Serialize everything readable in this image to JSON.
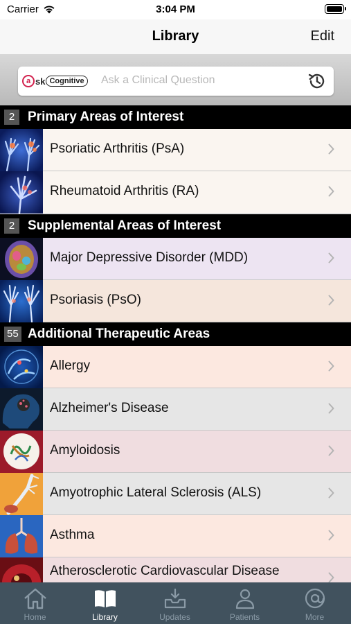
{
  "status": {
    "carrier": "Carrier",
    "time": "3:04 PM"
  },
  "nav": {
    "title": "Library",
    "edit": "Edit"
  },
  "search": {
    "logo_ask": "sk",
    "logo_brand": "Cognitive",
    "placeholder": "Ask a Clinical Question",
    "icon": "history-icon"
  },
  "sections": [
    {
      "count": "2",
      "title": "Primary Areas of Interest",
      "items": [
        {
          "label": "Psoriatic Arthritis (PsA)",
          "bg": "#faf5f0",
          "thumb": "hands-xray"
        },
        {
          "label": "Rheumatoid Arthritis (RA)",
          "bg": "#faf5f0",
          "thumb": "hand-xray"
        }
      ]
    },
    {
      "count": "2",
      "title": "Supplemental Areas of Interest",
      "items": [
        {
          "label": "Major Depressive Disorder (MDD)",
          "bg": "#ede4f2",
          "thumb": "brain-scan"
        },
        {
          "label": "Psoriasis (PsO)",
          "bg": "#f5e6dc",
          "thumb": "hands-blue"
        }
      ]
    },
    {
      "count": "55",
      "title": "Additional Therapeutic Areas",
      "items": [
        {
          "label": "Allergy",
          "bg": "#fce8e0",
          "thumb": "allergy-molecule"
        },
        {
          "label": "Alzheimer's Disease",
          "bg": "#e6e6e6",
          "thumb": "brain-dark"
        },
        {
          "label": "Amyloidosis",
          "bg": "#f0dde0",
          "thumb": "protein"
        },
        {
          "label": "Amyotrophic Lateral Sclerosis (ALS)",
          "bg": "#e6e6e6",
          "thumb": "neuron"
        },
        {
          "label": "Asthma",
          "bg": "#fce8e0",
          "thumb": "lungs"
        },
        {
          "label": "Atherosclerotic Cardiovascular Disease",
          "bg": "#f0dde0",
          "thumb": "artery"
        }
      ]
    }
  ],
  "tabs": [
    {
      "label": "Home",
      "icon": "home-icon"
    },
    {
      "label": "Library",
      "icon": "book-icon",
      "active": true
    },
    {
      "label": "Updates",
      "icon": "inbox-download-icon"
    },
    {
      "label": "Patients",
      "icon": "person-icon"
    },
    {
      "label": "More",
      "icon": "at-sign-icon"
    }
  ],
  "colors": {
    "tab_bar": "#41525e",
    "section_header": "#000000",
    "accent": "#d2224e"
  }
}
